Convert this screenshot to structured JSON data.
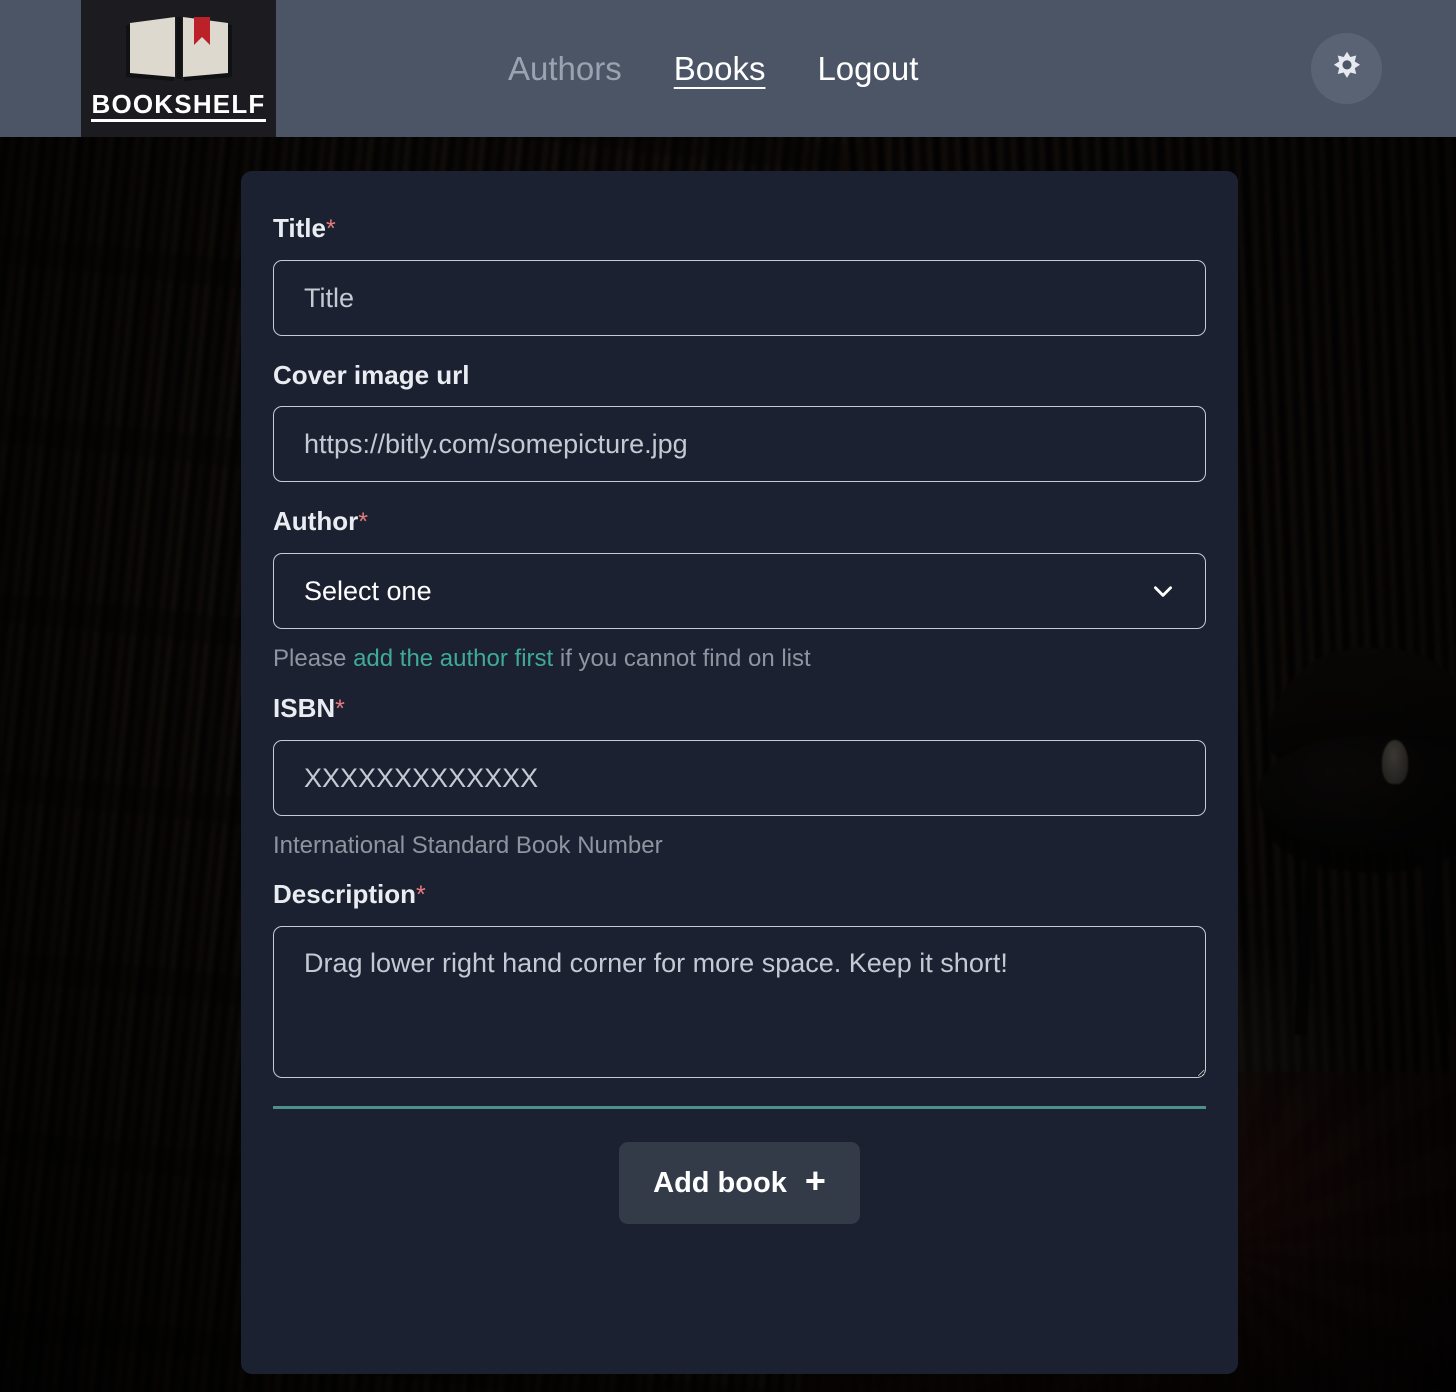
{
  "header": {
    "logo": {
      "text": "BOOKSHELF",
      "icon": "open-book-icon"
    },
    "nav": [
      {
        "label": "Authors",
        "state": "inactive"
      },
      {
        "label": "Books",
        "state": "active"
      },
      {
        "label": "Logout",
        "state": "inactive"
      }
    ],
    "theme_toggle_icon": "sun-gear-icon",
    "background_color": "#4b5566"
  },
  "card": {
    "background_color": "#1b2130",
    "fields": {
      "title": {
        "label": "Title",
        "required_marker": "*",
        "placeholder": "Title",
        "value": ""
      },
      "cover_image_url": {
        "label": "Cover image url",
        "placeholder": "https://bitly.com/somepicture.jpg",
        "value": ""
      },
      "author": {
        "label": "Author",
        "required_marker": "*",
        "selected_option": "Select one",
        "options": [
          "Select one"
        ],
        "chevron_icon": "chevron-down-icon",
        "helper_prefix": "Please ",
        "helper_link": "add the author first",
        "helper_suffix": " if you cannot find on list",
        "link_color": "#3fa99a"
      },
      "isbn": {
        "label": "ISBN",
        "required_marker": "*",
        "placeholder": "XXXXXXXXXXXXX",
        "value": "",
        "helper": "International Standard Book Number"
      },
      "description": {
        "label": "Description",
        "required_marker": "*",
        "placeholder": "Drag lower right hand corner for more space. Keep it short!",
        "value": ""
      }
    },
    "divider_color": "#4d8f89",
    "submit": {
      "label": "Add book",
      "icon": "plus-icon",
      "icon_glyph": "+"
    }
  },
  "background": {
    "description_alt": "dark blurred library bookshelves with table and chair"
  }
}
